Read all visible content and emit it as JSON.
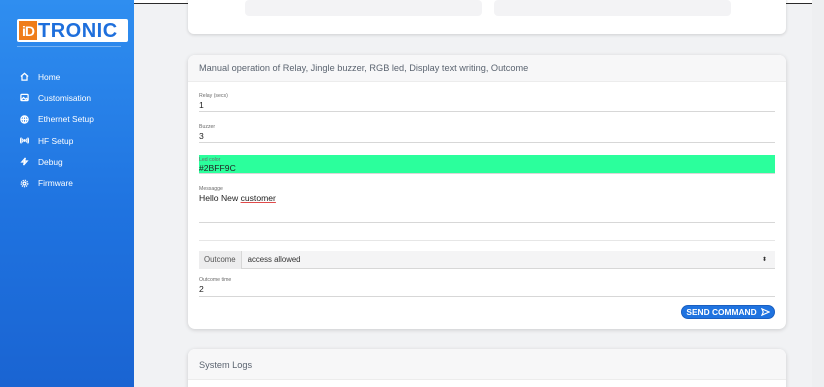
{
  "brand": {
    "logo_mark": "iD",
    "logo_text": "TRONIC",
    "accent": "#1f73e0",
    "logo_orange": "#ef7d1a"
  },
  "sidebar": {
    "items": [
      {
        "label": "Home",
        "icon": "home-icon"
      },
      {
        "label": "Customisation",
        "icon": "image-icon"
      },
      {
        "label": "Ethernet Setup",
        "icon": "globe-icon"
      },
      {
        "label": "HF Setup",
        "icon": "antenna-icon"
      },
      {
        "label": "Debug",
        "icon": "bolt-icon"
      },
      {
        "label": "Firmware",
        "icon": "gear-icon"
      }
    ]
  },
  "manual": {
    "title": "Manual operation of Relay, Jingle buzzer, RGB led, Display text writing, Outcome",
    "relay": {
      "label": "Relay (secs)",
      "value": "1"
    },
    "buzzer": {
      "label": "Buzzer",
      "value": "3"
    },
    "led": {
      "label": "Led color",
      "value": "#2BFF9C",
      "swatch": "#2bff9c"
    },
    "message": {
      "label": "Messagge",
      "value_plain": "Hello New ",
      "value_underlined": "customer"
    },
    "outcome": {
      "label": "Outcome",
      "selected": "access allowed",
      "caret": "⬍"
    },
    "outcome_time": {
      "label": "Outcome time",
      "value": "2"
    },
    "send_button": "SEND COMMAND"
  },
  "logs": {
    "title": "System Logs"
  }
}
